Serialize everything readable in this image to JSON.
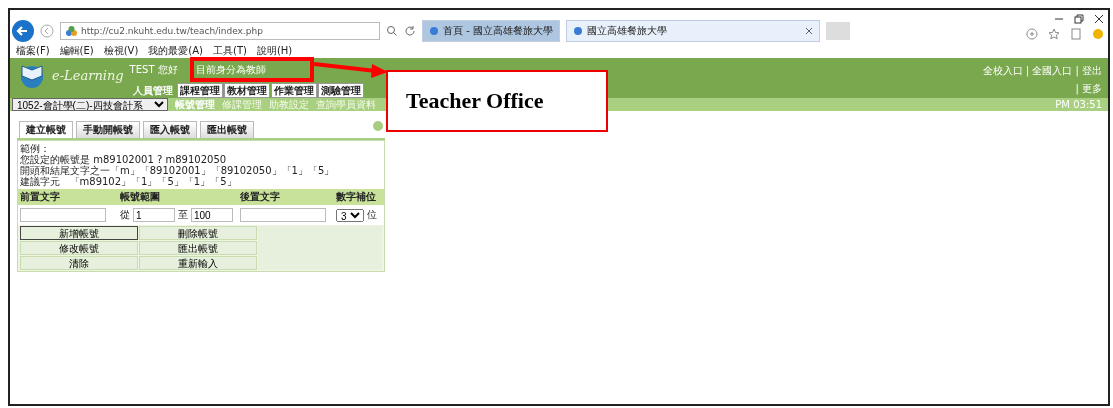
{
  "browser": {
    "address": "http://cu2.nkuht.edu.tw/teach/index.php",
    "tabs": [
      {
        "title": "首頁 - 國立高雄餐旅大學",
        "selected": false
      },
      {
        "title": "國立高雄餐旅大學",
        "selected": true
      }
    ],
    "menu": [
      "檔案(F)",
      "編輯(E)",
      "檢視(V)",
      "我的最愛(A)",
      "工具(T)",
      "說明(H)"
    ]
  },
  "header": {
    "logo": "e-Learning",
    "greeting": "TEST 您好",
    "role": "目前身分為教師",
    "links": "全校入口 | 全國入口 | 登出",
    "more": "| 更多",
    "course": "1052-會計學(二)-四技會計系",
    "nav_tabs": [
      {
        "label": "人員管理",
        "selected": true
      },
      {
        "label": "課程管理",
        "selected": false
      },
      {
        "label": "教材管理",
        "selected": false
      },
      {
        "label": "作業管理",
        "selected": false
      },
      {
        "label": "測驗管理",
        "selected": false
      }
    ],
    "subnav": [
      {
        "label": "帳號管理",
        "selected": true
      },
      {
        "label": "修課管理",
        "selected": false
      },
      {
        "label": "助教設定",
        "selected": false
      },
      {
        "label": "查詢學員資料",
        "selected": false
      }
    ],
    "clock": "PM 03:51"
  },
  "panel": {
    "tabs": [
      {
        "label": "建立帳號",
        "selected": true
      },
      {
        "label": "手動開帳號",
        "selected": false
      },
      {
        "label": "匯入帳號",
        "selected": false
      },
      {
        "label": "匯出帳號",
        "selected": false
      }
    ],
    "notes": [
      "範例：",
      "您設定的帳號是 m89102001 ? m89102050",
      "開頭和結尾文字之一「m」「89102001」「89102050」「1」「5」",
      "建議字元   「m89102」「1」「5」「1」「5」"
    ],
    "columns": [
      "前置文字",
      "帳號範圍",
      "後置文字",
      "數字補位"
    ],
    "from_label": "從",
    "from_value": "1",
    "to_label": "至",
    "to_value": "100",
    "pad_value": "3",
    "pad_unit": "位",
    "buttons": [
      "新增帳號",
      "刪除帳號",
      "修改帳號",
      "匯出帳號",
      "清除",
      "重新輸入"
    ]
  },
  "annotation": {
    "label": "Teacher Office"
  }
}
